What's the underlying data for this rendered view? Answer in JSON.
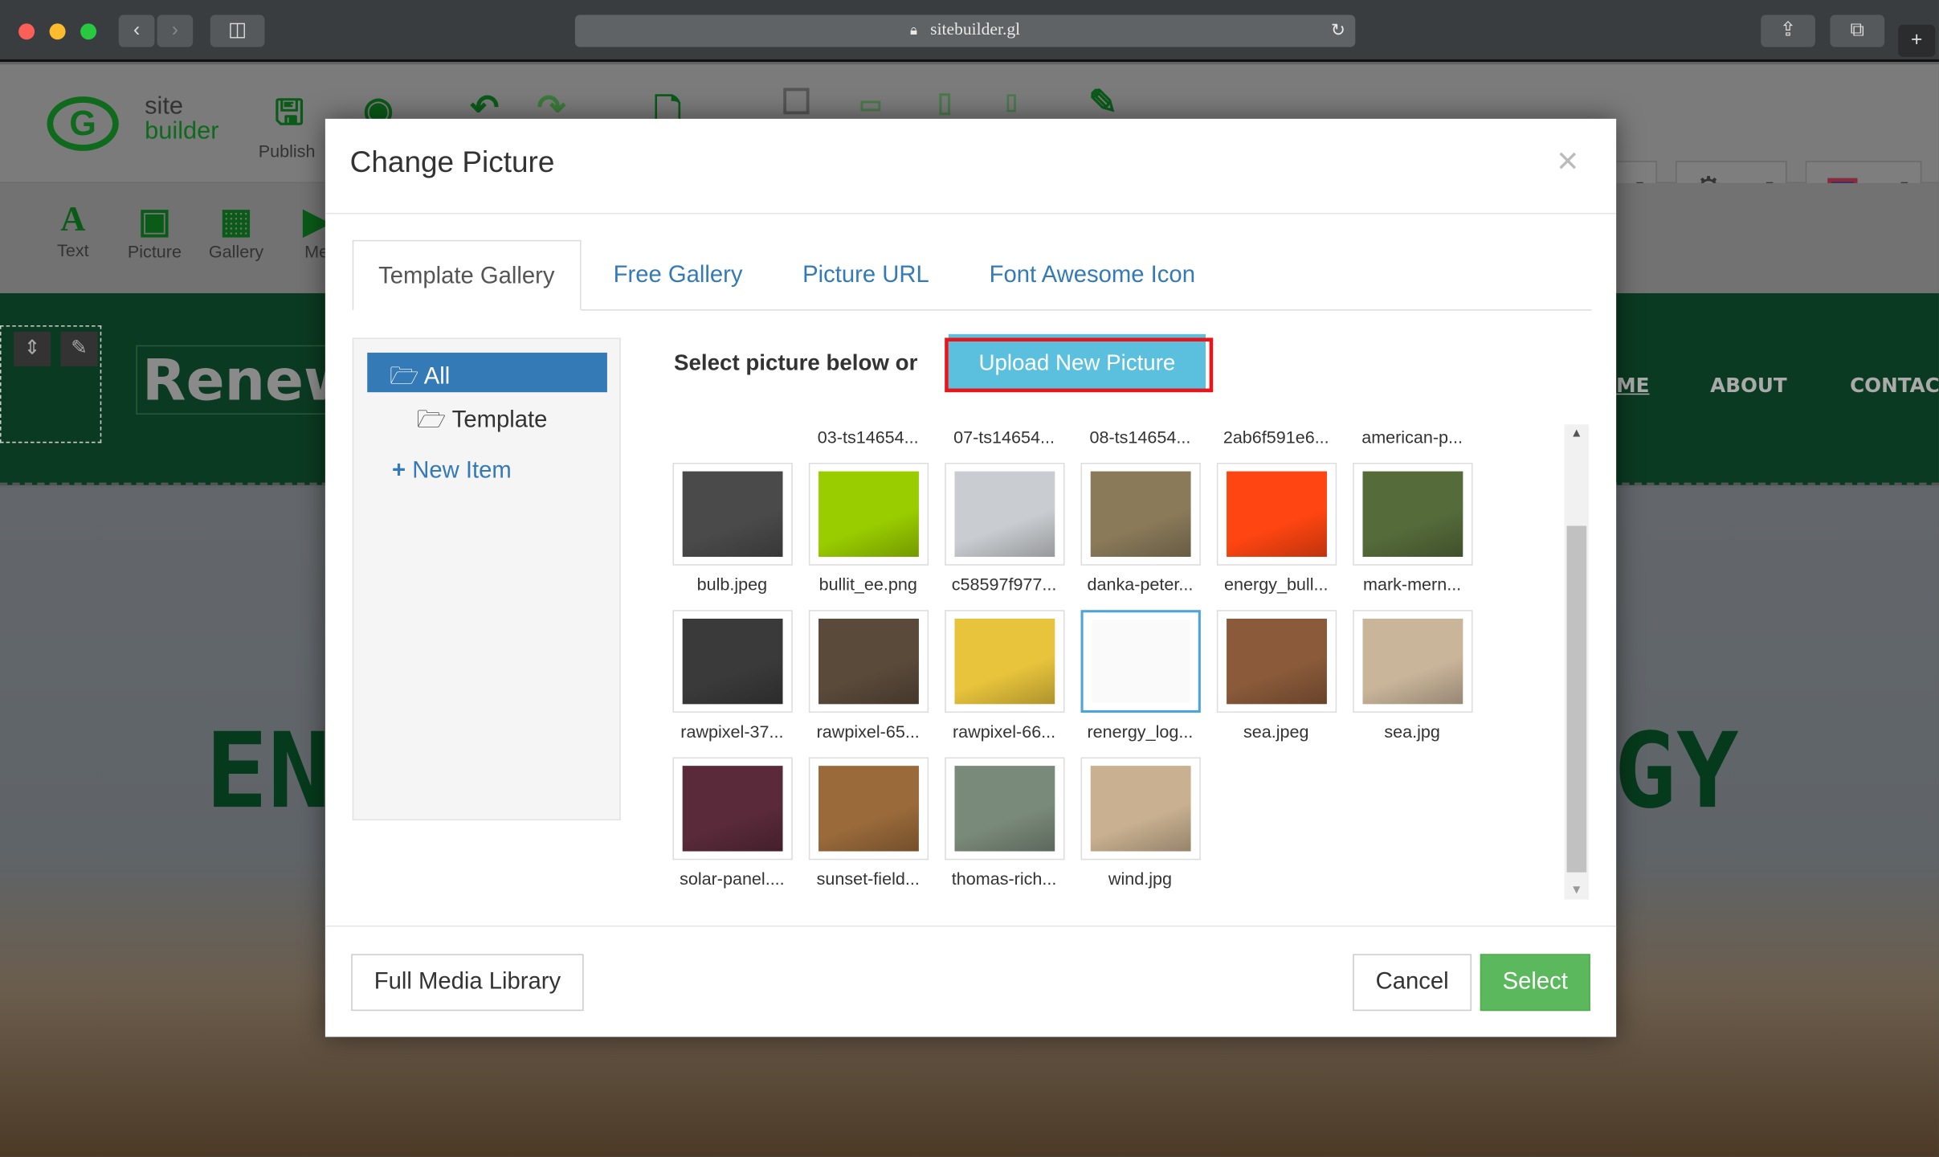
{
  "browser": {
    "url": "sitebuilder.gl",
    "lock_icon": "lock-icon",
    "reload_icon": "reload-icon"
  },
  "app": {
    "logo_line1": "site",
    "logo_line2": "builder",
    "publish_label": "Publish",
    "tools": [
      {
        "label": "Text",
        "icon": "A"
      },
      {
        "label": "Picture",
        "icon": "▣"
      },
      {
        "label": "Gallery",
        "icon": "▦"
      },
      {
        "label": "Me",
        "icon": "▶"
      }
    ],
    "site_logo_text": "Renew",
    "nav": [
      "ME",
      "ABOUT",
      "CONTAC"
    ],
    "hero_left": "EN",
    "hero_right": "GY"
  },
  "modal": {
    "title": "Change Picture",
    "close_icon": "×",
    "tabs": [
      {
        "label": "Template Gallery",
        "active": true
      },
      {
        "label": "Free Gallery"
      },
      {
        "label": "Picture URL"
      },
      {
        "label": "Font Awesome Icon"
      }
    ],
    "folders": {
      "all": "All",
      "template": "Template",
      "new_item": "New Item"
    },
    "select_text": "Select picture below or",
    "upload_label": "Upload New Picture",
    "top_row_labels": [
      "03-ts14654...",
      "07-ts14654...",
      "08-ts14654...",
      "2ab6f591e6...",
      "american-p..."
    ],
    "images": [
      {
        "label": "bulb.jpeg",
        "color": "#4a4a4a"
      },
      {
        "label": "bullit_ee.png",
        "color": "#9acd00"
      },
      {
        "label": "c58597f977...",
        "color": "#c9ccd0"
      },
      {
        "label": "danka-peter...",
        "color": "#8a7a5a"
      },
      {
        "label": "energy_bull...",
        "color": "#ff4511"
      },
      {
        "label": "mark-mern...",
        "color": "#556b3a"
      },
      {
        "label": "rawpixel-37...",
        "color": "#3a3a3a"
      },
      {
        "label": "rawpixel-65...",
        "color": "#5a4a3a"
      },
      {
        "label": "rawpixel-66...",
        "color": "#e8c43c"
      },
      {
        "label": "renergy_log...",
        "color": "#fafafa",
        "selected": true
      },
      {
        "label": "sea.jpeg",
        "color": "#8a5a3a"
      },
      {
        "label": "sea.jpg",
        "color": "#c9b59a"
      },
      {
        "label": "solar-panel....",
        "color": "#5a2a3a"
      },
      {
        "label": "sunset-field...",
        "color": "#9a6a3a"
      },
      {
        "label": "thomas-rich...",
        "color": "#7a8a7a"
      },
      {
        "label": "wind.jpg",
        "color": "#c8b090"
      }
    ],
    "full_media_label": "Full Media Library",
    "cancel_label": "Cancel",
    "select_label": "Select"
  },
  "colors": {
    "primary": "#337ab7",
    "upload": "#5bc0de",
    "select": "#5cb85c",
    "highlight": "#e8151b"
  }
}
